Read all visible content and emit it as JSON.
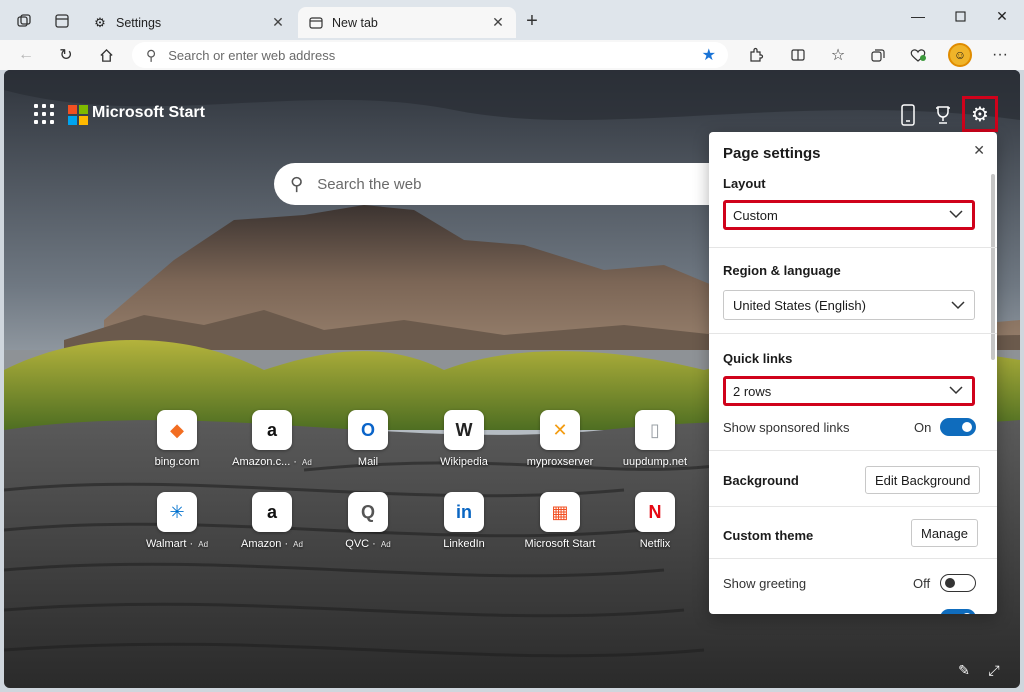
{
  "tabs": [
    {
      "title": "Settings",
      "icon": "gear-icon"
    },
    {
      "title": "New tab",
      "icon": "newtab-icon"
    }
  ],
  "address_bar": {
    "placeholder": "Search or enter web address"
  },
  "header": {
    "brand": "Microsoft Start"
  },
  "search": {
    "placeholder": "Search the web"
  },
  "quick_links": [
    {
      "label": "bing.com",
      "ad": "",
      "glyph": "◆",
      "color": "#f26d21"
    },
    {
      "label": "Amazon.c...",
      "ad": "Ad",
      "glyph": "a",
      "color": "#111111"
    },
    {
      "label": "Mail",
      "ad": "",
      "glyph": "O",
      "color": "#0a64c9"
    },
    {
      "label": "Wikipedia",
      "ad": "",
      "glyph": "W",
      "color": "#222222"
    },
    {
      "label": "myproxserver",
      "ad": "",
      "glyph": "✕",
      "color": "#f39c12"
    },
    {
      "label": "uupdump.net",
      "ad": "",
      "glyph": "▯",
      "color": "#9aa0a6"
    },
    {
      "label": "Walmart",
      "ad": "Ad",
      "glyph": "✳",
      "color": "#0071ce"
    },
    {
      "label": "Amazon",
      "ad": "Ad",
      "glyph": "a",
      "color": "#111111"
    },
    {
      "label": "QVC",
      "ad": "Ad",
      "glyph": "Q",
      "color": "#555555"
    },
    {
      "label": "LinkedIn",
      "ad": "",
      "glyph": "in",
      "color": "#0a66c2"
    },
    {
      "label": "Microsoft Start",
      "ad": "",
      "glyph": "▦",
      "color": "#f25022"
    },
    {
      "label": "Netflix",
      "ad": "",
      "glyph": "N",
      "color": "#e50914"
    }
  ],
  "panel": {
    "title": "Page settings",
    "layout_label": "Layout",
    "layout_value": "Custom",
    "region_label": "Region & language",
    "region_value": "United States (English)",
    "quick_links_label": "Quick links",
    "quick_links_value": "2 rows",
    "sponsored_label": "Show sponsored links",
    "sponsored_state": "On",
    "background_label": "Background",
    "background_button": "Edit Background",
    "theme_label": "Custom theme",
    "theme_button": "Manage",
    "greeting_label": "Show greeting",
    "greeting_state": "Off"
  },
  "colors": {
    "accent": "#0f6cbd",
    "highlight": "#d0021b",
    "favorite_star": "#1a73d6"
  }
}
